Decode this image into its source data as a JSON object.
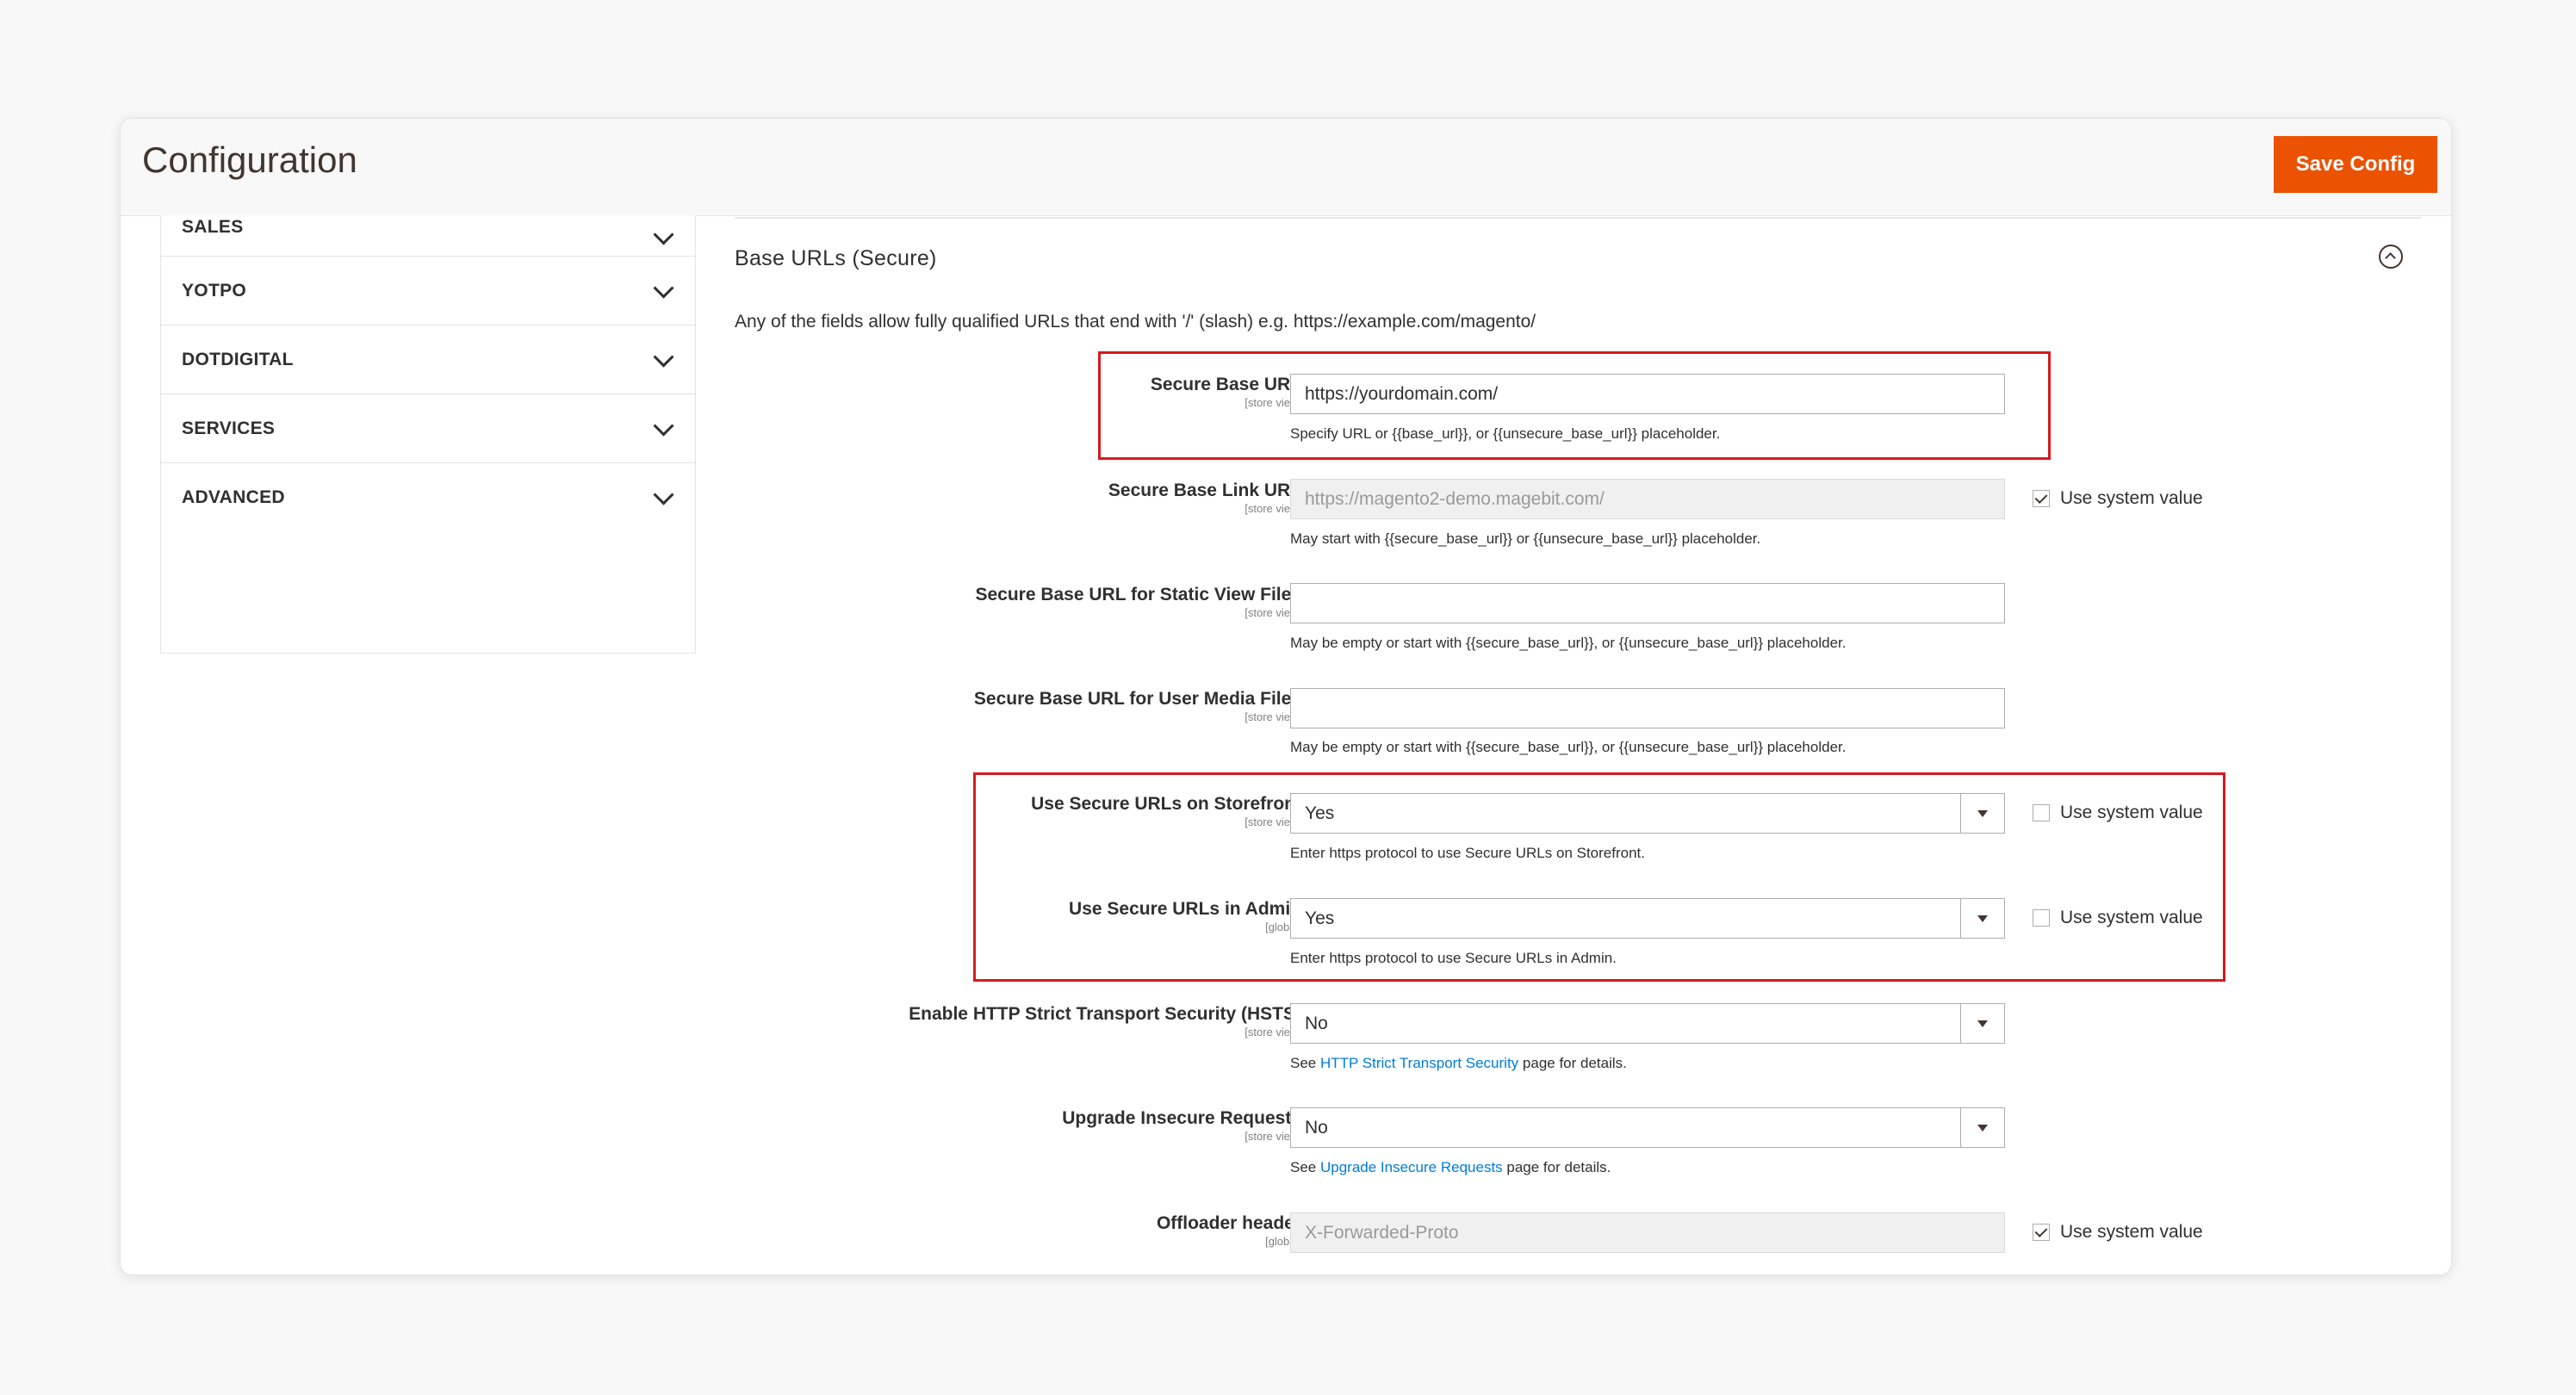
{
  "header": {
    "title": "Configuration",
    "save_label": "Save Config"
  },
  "sidebar": {
    "items": [
      {
        "label": "SALES"
      },
      {
        "label": "YOTPO"
      },
      {
        "label": "DOTDIGITAL"
      },
      {
        "label": "SERVICES"
      },
      {
        "label": "ADVANCED"
      }
    ]
  },
  "section": {
    "title": "Base URLs (Secure)",
    "description": "Any of the fields allow fully qualified URLs that end with '/' (slash) e.g. https://example.com/magento/"
  },
  "use_system_value_label": "Use system value",
  "fields": {
    "secure_base_url": {
      "label": "Secure Base URL",
      "scope": "[store view]",
      "value": "https://yourdomain.com/",
      "note": "Specify URL or {{base_url}}, or {{unsecure_base_url}} placeholder."
    },
    "secure_base_link_url": {
      "label": "Secure Base Link URL",
      "scope": "[store view]",
      "value": "https://magento2-demo.magebit.com/",
      "note": "May start with {{secure_base_url}} or {{unsecure_base_url}} placeholder.",
      "use_system_value": true
    },
    "static_view_files": {
      "label": "Secure Base URL for Static View Files",
      "scope": "[store view]",
      "value": "",
      "note": "May be empty or start with {{secure_base_url}}, or {{unsecure_base_url}} placeholder."
    },
    "user_media_files": {
      "label": "Secure Base URL for User Media Files",
      "scope": "[store view]",
      "value": "",
      "note": "May be empty or start with {{secure_base_url}}, or {{unsecure_base_url}} placeholder."
    },
    "secure_storefront": {
      "label": "Use Secure URLs on Storefront",
      "scope": "[store view]",
      "value": "Yes",
      "note": "Enter https protocol to use Secure URLs on Storefront.",
      "use_system_value": false
    },
    "secure_admin": {
      "label": "Use Secure URLs in Admin",
      "scope": "[global]",
      "value": "Yes",
      "note": "Enter https protocol to use Secure URLs in Admin.",
      "use_system_value": false
    },
    "hsts": {
      "label": "Enable HTTP Strict Transport Security (HSTS)",
      "scope": "[store view]",
      "value": "No",
      "note_prefix": "See ",
      "note_link": "HTTP Strict Transport Security",
      "note_suffix": " page for details."
    },
    "upgrade_insecure": {
      "label": "Upgrade Insecure Requests",
      "scope": "[store view]",
      "value": "No",
      "note_prefix": "See ",
      "note_link": "Upgrade Insecure Requests",
      "note_suffix": " page for details."
    },
    "offloader_header": {
      "label": "Offloader header",
      "scope": "[global]",
      "value": "X-Forwarded-Proto",
      "use_system_value": true
    }
  },
  "colors": {
    "accent": "#eb5202",
    "highlight": "#d71920",
    "link": "#007bdb"
  }
}
